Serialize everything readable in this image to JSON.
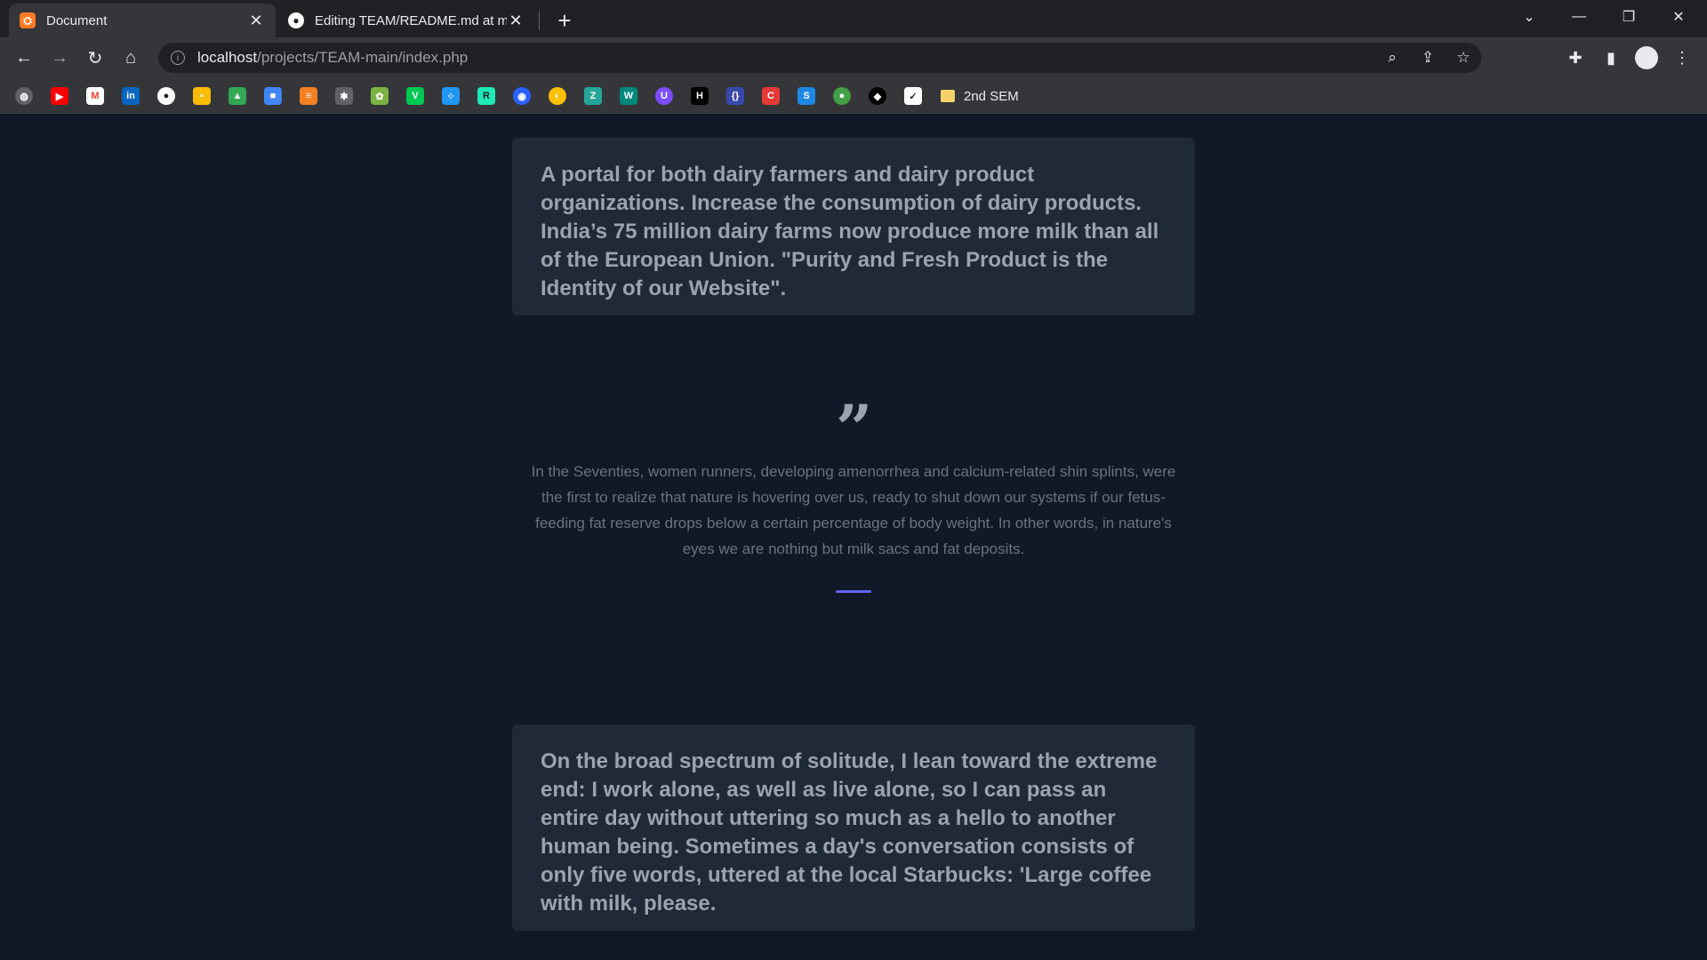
{
  "tabs": [
    {
      "title": "Document",
      "favicon": "xampp-icon",
      "active": true
    },
    {
      "title": "Editing TEAM/README.md at ma",
      "favicon": "github-icon",
      "active": false
    }
  ],
  "address_bar": {
    "host": "localhost",
    "path": "/projects/TEAM-main/index.php"
  },
  "bookmarks": {
    "folder_label": "2nd SEM"
  },
  "content": {
    "card1_text": "A portal for both dairy farmers and dairy product organizations. Increase the consumption of dairy products. India’s 75 million dairy farms now produce more milk than all of the European Union. \"Purity and Fresh Product is the Identity of our Website\".",
    "quote_text": "In the Seventies, women runners, developing amenorrhea and calcium-related shin splints, were the first to realize that nature is hovering over us, ready to shut down our systems if our fetus-feeding fat reserve drops below a certain percentage of body weight. In other words, in nature's eyes we are nothing but milk sacs and fat deposits.",
    "card2_text": "On the broad spectrum of solitude, I lean toward the extreme end: I work alone, as well as live alone, so I can pass an entire day without uttering so much as a hello to another human being. Sometimes a day's conversation consists of only five words, uttered at the local Starbucks: 'Large coffee with milk, please."
  },
  "colors": {
    "page_bg": "#111827",
    "card_bg": "#1f2937",
    "accent": "#6366f1"
  }
}
